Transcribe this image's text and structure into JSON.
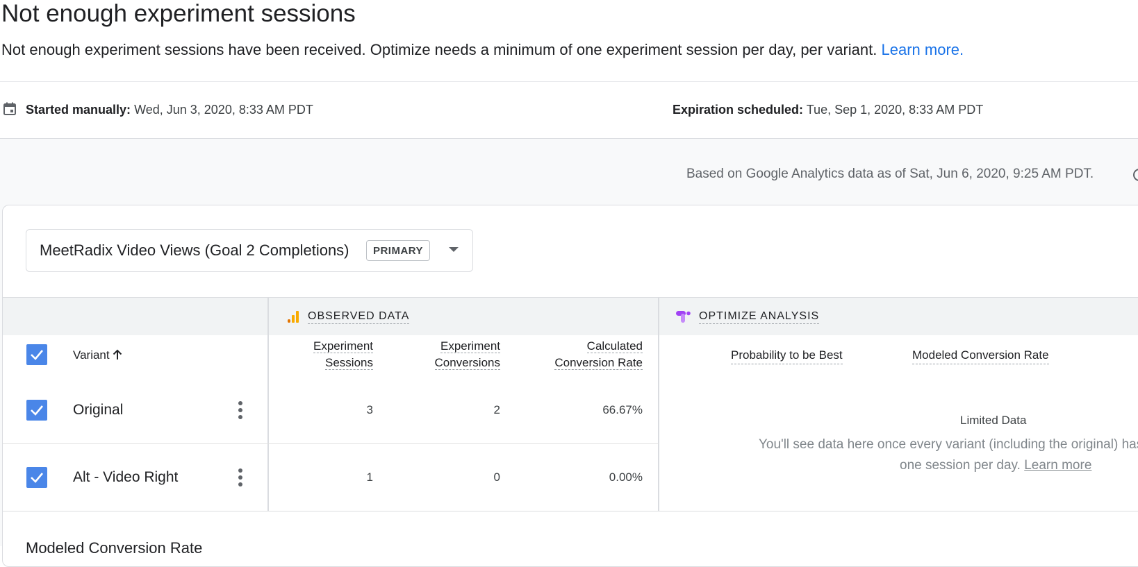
{
  "header": {
    "title": "Not enough experiment sessions",
    "message": "Not enough experiment sessions have been received. Optimize needs a minimum of one experiment session per day, per variant.",
    "learn_more": "Learn more."
  },
  "schedule": {
    "started_label": "Started manually:",
    "started_value": "Wed, Jun 3, 2020, 8:33 AM PDT",
    "expiration_label": "Expiration scheduled:",
    "expiration_value": "Tue, Sep 1, 2020, 8:33 AM PDT"
  },
  "data_asof": "Based on Google Analytics data as of Sat, Jun 6, 2020, 9:25 AM PDT.",
  "objective": {
    "selected": "MeetRadix Video Views (Goal 2 Completions)",
    "badge": "PRIMARY"
  },
  "table": {
    "observed_section": "OBSERVED DATA",
    "optimize_section": "OPTIMIZE ANALYSIS",
    "variant_header": "Variant",
    "columns": {
      "sessions_l1": "Experiment",
      "sessions_l2": "Sessions",
      "conversions_l1": "Experiment",
      "conversions_l2": "Conversions",
      "rate_l1": "Calculated",
      "rate_l2": "Conversion Rate",
      "prob_best": "Probability to be Best",
      "modeled_rate": "Modeled Conversion Rate"
    },
    "rows": [
      {
        "name": "Original",
        "sessions": "3",
        "conversions": "2",
        "rate": "66.67%"
      },
      {
        "name": "Alt - Video Right",
        "sessions": "1",
        "conversions": "0",
        "rate": "0.00%"
      }
    ],
    "limited": {
      "title": "Limited Data",
      "line1": "You'll see data here once every variant (including the original) has at least",
      "line2": "one session per day.",
      "link": "Learn more"
    }
  },
  "bottom_partial": "Modeled Conversion Rate",
  "colors": {
    "link": "#1a73e8",
    "checkbox": "#4a86e8",
    "observed_icon": "#f9ab00",
    "optimize_icon": "#a142f4"
  }
}
